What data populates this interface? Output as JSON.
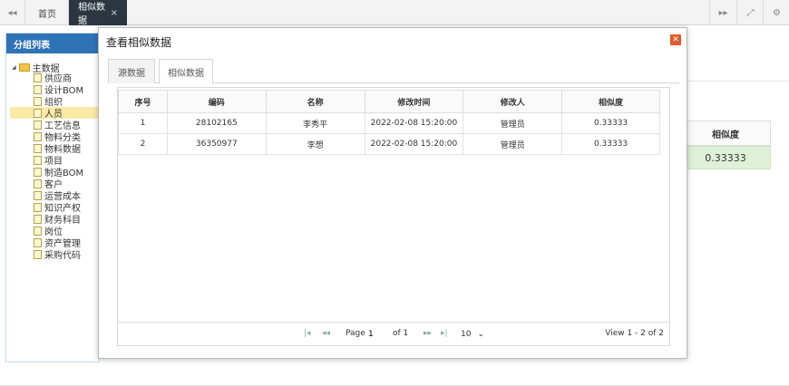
{
  "topbar": {
    "tabs": [
      {
        "label": "首页"
      },
      {
        "label": "相似数据",
        "close": "×"
      }
    ],
    "icons": [
      "double-left-arrow-icon",
      "double-right-arrow-icon",
      "fullscreen-icon",
      "gear-icon"
    ]
  },
  "background_grid": {
    "header": "相似度",
    "value": "0.33333"
  },
  "sidebar": {
    "title": "分组列表",
    "root": "主数据",
    "items": [
      "供应商",
      "设计BOM",
      "组织",
      "人员",
      "工艺信息",
      "物料分类",
      "物料数据",
      "项目",
      "制造BOM",
      "客户",
      "运营成本",
      "知识产权",
      "财务科目",
      "岗位",
      "资产管理",
      "采购代码"
    ],
    "selected": "人员"
  },
  "modal": {
    "title": "查看相似数据",
    "close": "✕",
    "tabs": [
      {
        "label": "源数据"
      },
      {
        "label": "相似数据"
      }
    ],
    "active_tab": "相似数据",
    "table": {
      "columns": [
        "序号",
        "编码",
        "名称",
        "修改时间",
        "修改人",
        "相似度"
      ],
      "rows": [
        [
          "1",
          "28102165",
          "李秀平",
          "2022-02-08 15:20:00",
          "管理员",
          "0.33333"
        ],
        [
          "2",
          "36350977",
          "李想",
          "2022-02-08 15:20:00",
          "管理员",
          "0.33333"
        ]
      ]
    },
    "pager": {
      "page_label": "Page",
      "page_value": "1",
      "of_label": "of 1",
      "page_size": "10",
      "view_text": "View 1 - 2 of 2"
    }
  }
}
